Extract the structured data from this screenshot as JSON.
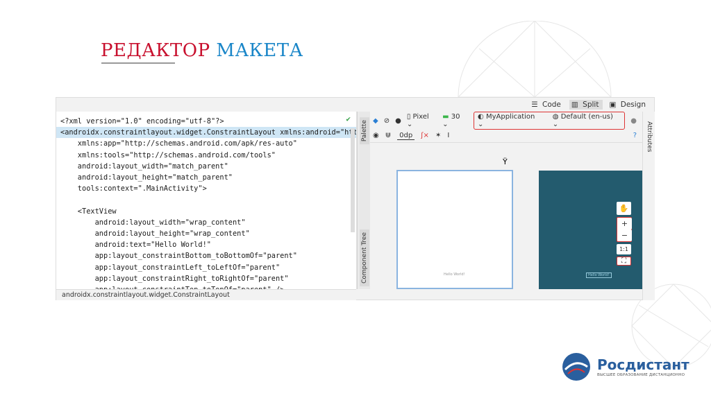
{
  "slide": {
    "title_part1": "РЕДАКТОР",
    "title_part2": "МАКЕТА"
  },
  "ide": {
    "modes": {
      "code": "Code",
      "split": "Split",
      "design": "Design"
    },
    "code_lines": [
      "<?xml version=\"1.0\" encoding=\"utf-8\"?>",
      "<androidx.constraintlayout.widget.ConstraintLayout xmlns:android=\"htt",
      "    xmlns:app=\"http://schemas.android.com/apk/res-auto\"",
      "    xmlns:tools=\"http://schemas.android.com/tools\"",
      "    android:layout_width=\"match_parent\"",
      "    android:layout_height=\"match_parent\"",
      "    tools:context=\".MainActivity\">",
      "",
      "    <TextView",
      "        android:layout_width=\"wrap_content\"",
      "        android:layout_height=\"wrap_content\"",
      "        android:text=\"Hello World!\"",
      "        app:layout_constraintBottom_toBottomOf=\"parent\"",
      "        app:layout_constraintLeft_toLeftOf=\"parent\"",
      "        app:layout_constraintRight_toRightOf=\"parent\"",
      "        app:layout_constraintTop_toTopOf=\"parent\" />"
    ],
    "status_bar": "androidx.constraintlayout.widget.ConstraintLayout",
    "palette_label": "Palette",
    "component_tree_label": "Component Tree",
    "attributes_label": "Attributes",
    "toolbar": {
      "device": "Pixel",
      "api": "30",
      "theme": "MyApplication",
      "locale": "Default (en-us)",
      "margin": "0dp"
    },
    "zoom": {
      "plus": "+",
      "minus": "−",
      "one_to_one": "1:1"
    },
    "preview_text": "Hello World!"
  },
  "logo": {
    "name": "Росдистант",
    "tagline": "ВЫСШЕЕ ОБРАЗОВАНИЕ ДИСТАНЦИОННО"
  },
  "colors": {
    "title_red": "#c8102e",
    "title_blue": "#1a86c8",
    "highlight": "#d33333",
    "preview_bg": "#235b6e"
  }
}
